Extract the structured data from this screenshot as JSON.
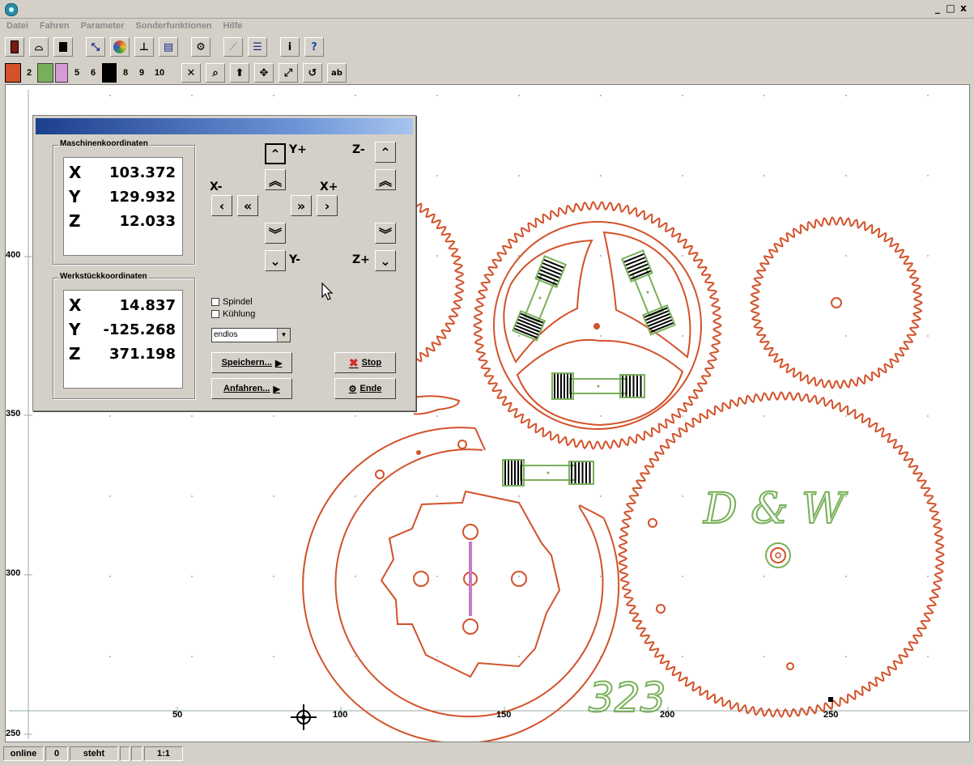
{
  "window": {
    "minimize": "_",
    "maximize": "□",
    "close": "x"
  },
  "menu": [
    "Datei",
    "Fahren",
    "Parameter",
    "Sonderfunktionen",
    "Hilfe"
  ],
  "pen_toolbar": {
    "pen2": "2",
    "pen5": "5",
    "pen6": "6",
    "pen8": "8",
    "pen9": "9",
    "pen10": "10"
  },
  "dialog": {
    "machine_group": "Maschinenkoordinaten",
    "machine": {
      "x_label": "X",
      "x": "103.372",
      "y_label": "Y",
      "y": "129.932",
      "z_label": "Z",
      "z": "12.033"
    },
    "work_group": "Werkstückkoordinaten",
    "work": {
      "x_label": "X",
      "x": "14.837",
      "y_label": "Y",
      "y": "-125.268",
      "z_label": "Z",
      "z": "371.198"
    },
    "jog": {
      "y_plus": "Y+",
      "y_minus": "Y-",
      "x_minus": "X-",
      "x_plus": "X+",
      "z_minus": "Z-",
      "z_plus": "Z+"
    },
    "spindel": "Spindel",
    "kuehlung": "Kühlung",
    "mode_value": "endlos",
    "save_button": "Speichern...",
    "approach_button": "Anfahren...",
    "stop_button": "Stop",
    "end_button": "Ende"
  },
  "axis": {
    "x_ticks": [
      "50",
      "100",
      "150",
      "200",
      "250"
    ],
    "y_ticks": [
      "400",
      "350",
      "300",
      "250"
    ]
  },
  "drawing": {
    "monogram": "D & W",
    "number": "323"
  },
  "status": {
    "online": "online",
    "zero": "0",
    "state": "steht",
    "scale": "1:1"
  },
  "colors": {
    "cut": "#d2522a",
    "engrave": "#78b05a",
    "mark": "#c87ac8"
  }
}
